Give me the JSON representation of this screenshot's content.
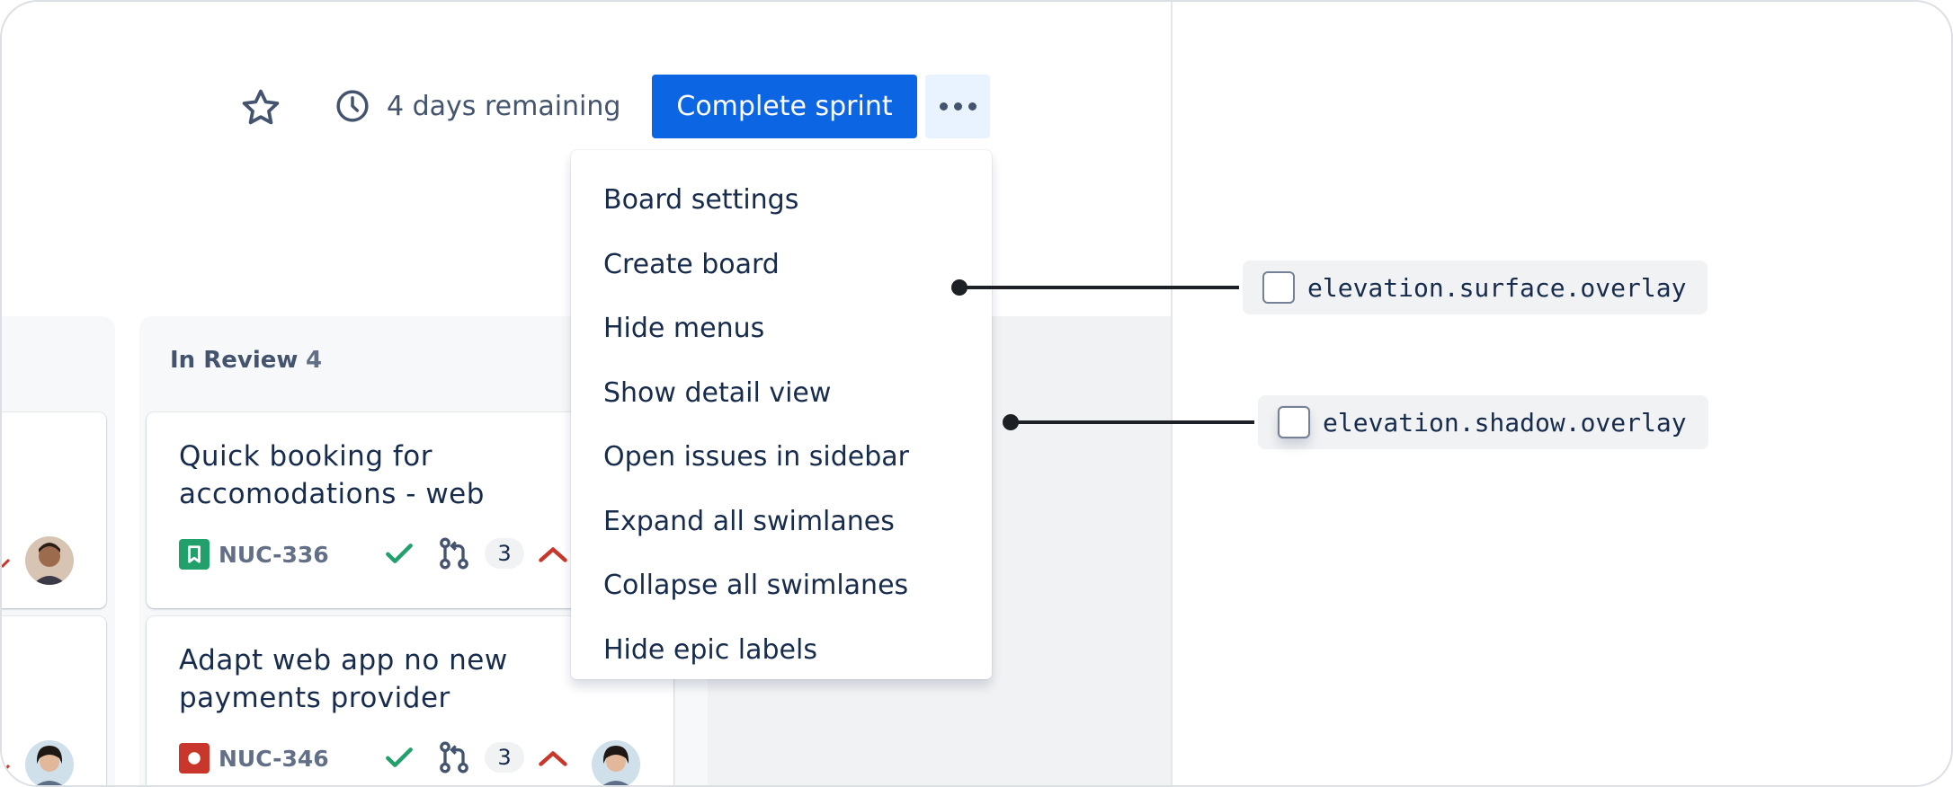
{
  "header": {
    "star_icon": "star-icon",
    "clock_icon": "clock-icon",
    "days_remaining": "4 days remaining",
    "complete_sprint_label": "Complete sprint",
    "more_icon": "more-horizontal-icon"
  },
  "board": {
    "column": {
      "title": "In Review",
      "count": "4"
    },
    "cards": [
      {
        "title": "Quick booking for accomodations - web",
        "issue_type_icon": "story-icon",
        "issue_key": "NUC-336",
        "status_icon": "check-icon",
        "pull_request_icon": "pull-request-icon",
        "pr_count": "3",
        "priority_icon": "priority-high-icon"
      },
      {
        "title": "Adapt web app no new payments provider",
        "issue_type_icon": "bug-icon",
        "issue_key": "NUC-346",
        "status_icon": "check-icon",
        "pull_request_icon": "pull-request-icon",
        "pr_count": "3",
        "priority_icon": "priority-high-icon"
      }
    ]
  },
  "menu": {
    "items": [
      "Board settings",
      "Create board",
      "Hide menus",
      "Show detail view",
      "Open issues in sidebar",
      "Expand all swimlanes",
      "Collapse all swimlanes",
      "Hide epic labels"
    ]
  },
  "annotations": [
    {
      "token": "elevation.surface.overlay"
    },
    {
      "token": "elevation.shadow.overlay"
    }
  ],
  "colors": {
    "brand": "#0c66e4",
    "text": "#172b4d",
    "subtle_text": "#44546f",
    "success": "#22a06b",
    "danger": "#c9372c",
    "story": "#22a06b",
    "bug": "#c9372c"
  }
}
